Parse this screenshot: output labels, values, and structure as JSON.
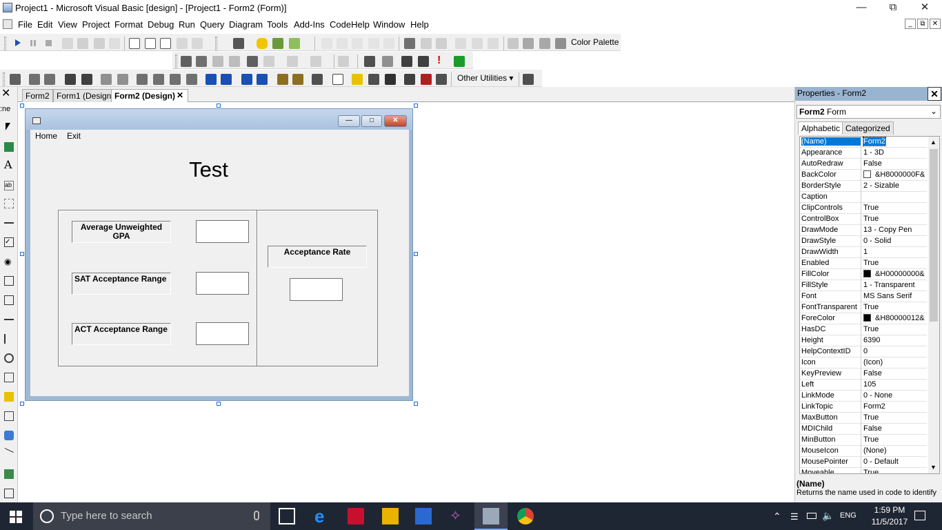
{
  "window": {
    "title": "Project1 - Microsoft Visual Basic [design] - [Project1 - Form2 (Form)]",
    "minimize": "—",
    "restore": "⧉",
    "close": "✕"
  },
  "menu": {
    "items": [
      "File",
      "Edit",
      "View",
      "Project",
      "Format",
      "Debug",
      "Run",
      "Query",
      "Diagram",
      "Tools",
      "Add-Ins",
      "CodeHelp",
      "Window",
      "Help"
    ]
  },
  "toolbar": {
    "color_palette": "Color Palette",
    "other_utilities": "Other Utilities ▾"
  },
  "tabs": {
    "items": [
      "Form2",
      "Form1 (Design)",
      "Form2 (Design)"
    ],
    "close_glyph": "✕",
    "left_stub": ":ne"
  },
  "form": {
    "menu": [
      "Home",
      "Exit"
    ],
    "heading": "Test",
    "labels": {
      "gpa": "Average Unweighted GPA",
      "sat": "SAT Acceptance Range",
      "act": "ACT Acceptance Range",
      "rate": "Acceptance Rate"
    },
    "inputs": {
      "gpa": "",
      "sat": "",
      "act": "",
      "rate": ""
    }
  },
  "properties": {
    "title": "Properties - Form2",
    "object_name": "Form2",
    "object_type": "Form",
    "tabs": [
      "Alphabetic",
      "Categorized"
    ],
    "rows": [
      {
        "name": "(Name)",
        "value": "Form2",
        "selected": true
      },
      {
        "name": "Appearance",
        "value": "1 - 3D"
      },
      {
        "name": "AutoRedraw",
        "value": "False"
      },
      {
        "name": "BackColor",
        "value": "&H8000000F&",
        "swatch": "#ffffff"
      },
      {
        "name": "BorderStyle",
        "value": "2 - Sizable"
      },
      {
        "name": "Caption",
        "value": ""
      },
      {
        "name": "ClipControls",
        "value": "True"
      },
      {
        "name": "ControlBox",
        "value": "True"
      },
      {
        "name": "DrawMode",
        "value": "13 - Copy Pen"
      },
      {
        "name": "DrawStyle",
        "value": "0 - Solid"
      },
      {
        "name": "DrawWidth",
        "value": "1"
      },
      {
        "name": "Enabled",
        "value": "True"
      },
      {
        "name": "FillColor",
        "value": "&H00000000&",
        "swatch": "#000000"
      },
      {
        "name": "FillStyle",
        "value": "1 - Transparent"
      },
      {
        "name": "Font",
        "value": "MS Sans Serif"
      },
      {
        "name": "FontTransparent",
        "value": "True"
      },
      {
        "name": "ForeColor",
        "value": "&H80000012&",
        "swatch": "#000000"
      },
      {
        "name": "HasDC",
        "value": "True"
      },
      {
        "name": "Height",
        "value": "6390"
      },
      {
        "name": "HelpContextID",
        "value": "0"
      },
      {
        "name": "Icon",
        "value": "(Icon)"
      },
      {
        "name": "KeyPreview",
        "value": "False"
      },
      {
        "name": "Left",
        "value": "105"
      },
      {
        "name": "LinkMode",
        "value": "0 - None"
      },
      {
        "name": "LinkTopic",
        "value": "Form2"
      },
      {
        "name": "MaxButton",
        "value": "True"
      },
      {
        "name": "MDIChild",
        "value": "False"
      },
      {
        "name": "MinButton",
        "value": "True"
      },
      {
        "name": "MouseIcon",
        "value": "(None)"
      },
      {
        "name": "MousePointer",
        "value": "0 - Default"
      },
      {
        "name": "Moveable",
        "value": "True"
      }
    ],
    "desc_title": "(Name)",
    "desc_text": "Returns the name used in code to identify"
  },
  "taskbar": {
    "search_placeholder": "Type here to search",
    "lang": "ENG",
    "time": "1:59 PM",
    "date": "11/5/2017"
  },
  "colors": {
    "title_active": "#99b4d1",
    "selection": "#0078d7",
    "taskbar": "#1f2633"
  }
}
